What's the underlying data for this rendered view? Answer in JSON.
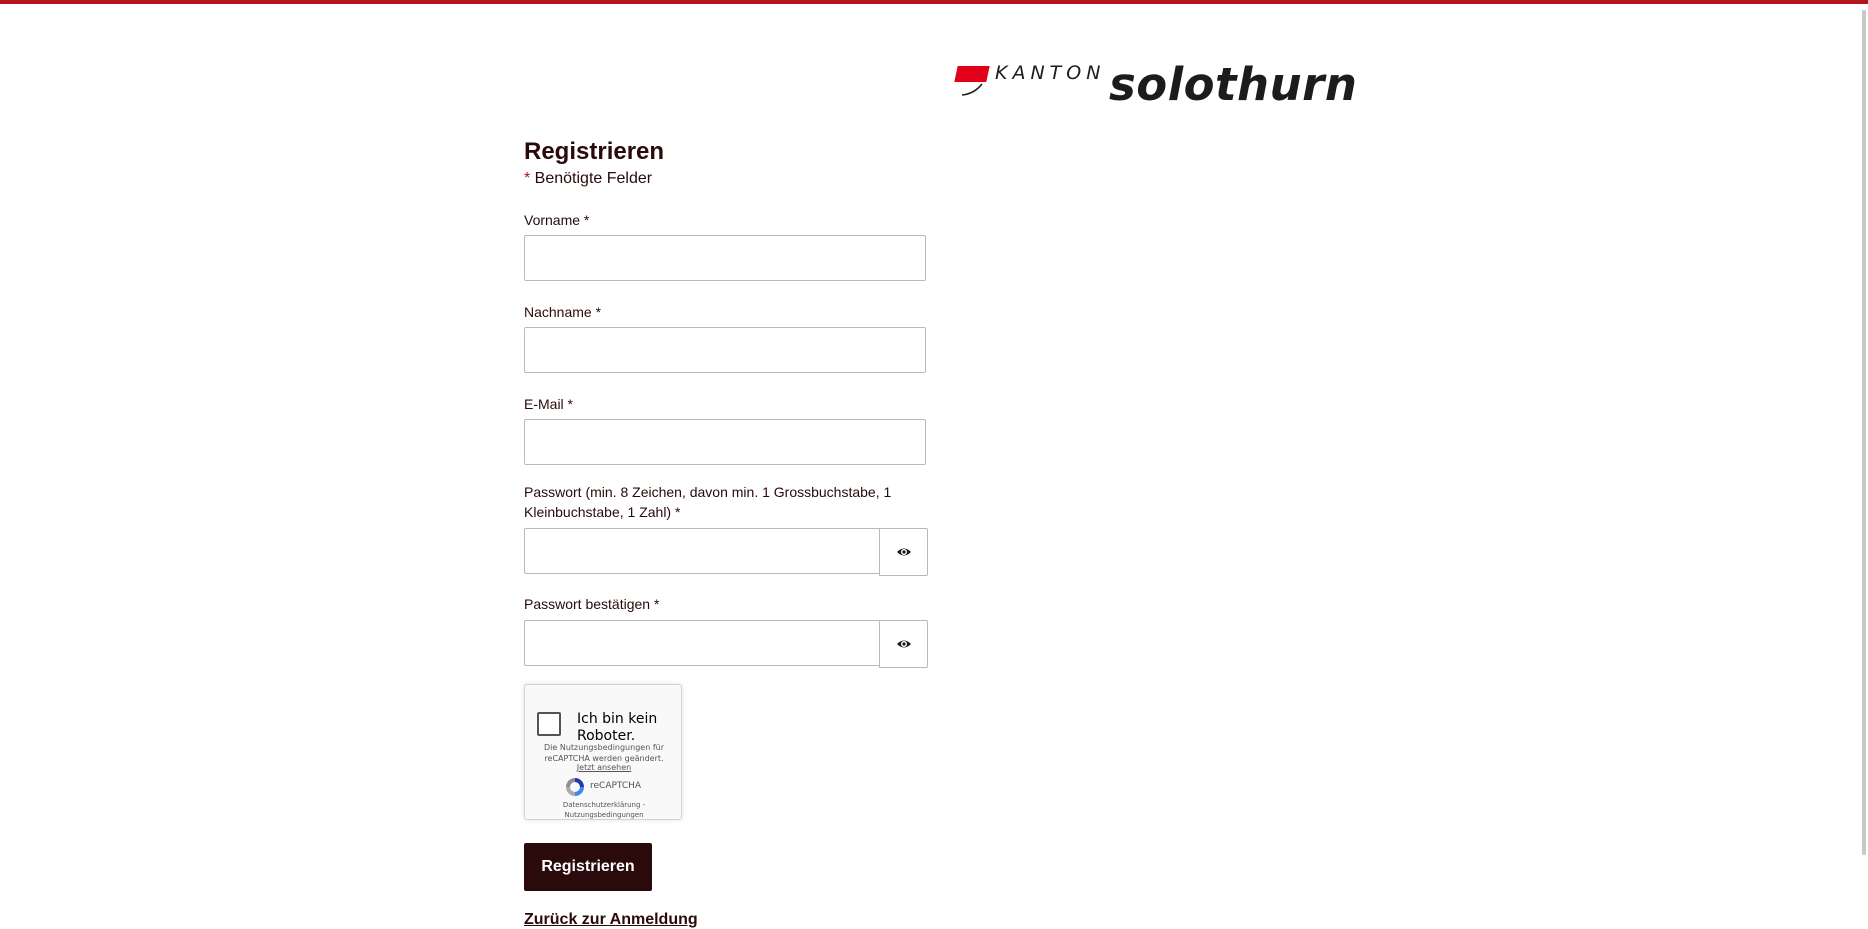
{
  "colors": {
    "accent": "#b3151b",
    "text": "#2a0a0a",
    "button_bg": "#2a0a0a",
    "logo_flag": "#e3001b"
  },
  "logo": {
    "kanton": "KANTON",
    "name": "solothurn"
  },
  "form": {
    "title": "Registrieren",
    "required_star": "*",
    "required_note": " Benötigte Felder",
    "fields": {
      "firstname": {
        "label": "Vorname *",
        "value": ""
      },
      "lastname": {
        "label": "Nachname *",
        "value": ""
      },
      "email": {
        "label": "E-Mail *",
        "value": ""
      },
      "password": {
        "label": "Passwort (min. 8 Zeichen, davon min. 1 Grossbuchstabe, 1 Kleinbuchstabe, 1 Zahl) *",
        "value": "",
        "toggle_icon": "eye-icon"
      },
      "password_confirm": {
        "label": "Passwort bestätigen *",
        "value": "",
        "toggle_icon": "eye-icon"
      }
    },
    "captcha": {
      "checkbox_label": "Ich bin kein Roboter.",
      "terms_notice": "Die Nutzungsbedingungen für reCAPTCHA werden geändert.",
      "view_link": "Jetzt ansehen",
      "brand": "reCAPTCHA",
      "links": "Datenschutzerklärung - Nutzungsbedingungen"
    },
    "submit_label": "Registrieren",
    "back_link": "Zurück zur Anmeldung"
  }
}
